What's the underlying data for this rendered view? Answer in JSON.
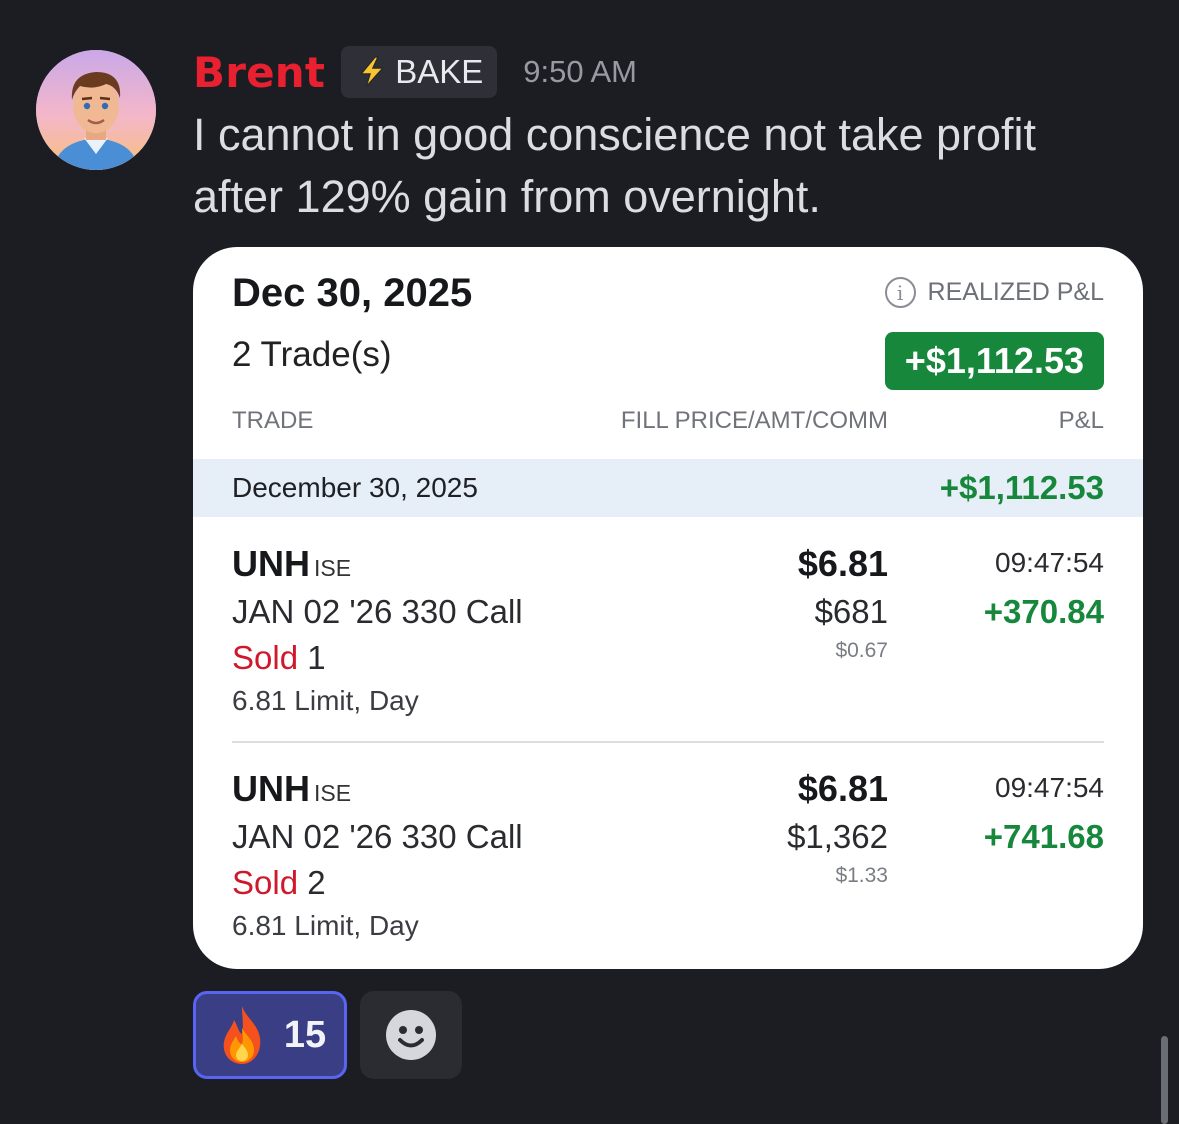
{
  "message": {
    "username": "Brent",
    "tag": "BAKE",
    "time": "9:50 AM",
    "text": "I cannot in good conscience not take profit after 129% gain from overnight."
  },
  "card": {
    "date": "Dec 30, 2025",
    "trades_count": "2 Trade(s)",
    "realized_label": "REALIZED P&L",
    "realized_total": "+$1,112.53",
    "columns": {
      "trade": "TRADE",
      "fill": "FILL PRICE/AMT/COMM",
      "pl": "P&L"
    },
    "day": {
      "label": "December 30, 2025",
      "pl": "+$1,112.53"
    },
    "trades": [
      {
        "symbol": "UNH",
        "exchange": "ISE",
        "contract": "JAN 02 '26 330 Call",
        "side": "Sold",
        "qty": "1",
        "order": "6.81 Limit, Day",
        "price": "$6.81",
        "amount": "$681",
        "commission": "$0.67",
        "time": "09:47:54",
        "pl": "+370.84"
      },
      {
        "symbol": "UNH",
        "exchange": "ISE",
        "contract": "JAN 02 '26 330 Call",
        "side": "Sold",
        "qty": "2",
        "order": "6.81 Limit, Day",
        "price": "$6.81",
        "amount": "$1,362",
        "commission": "$1.33",
        "time": "09:47:54",
        "pl": "+741.68"
      }
    ]
  },
  "reactions": [
    {
      "icon": "fire-icon",
      "count": "15"
    }
  ],
  "colors": {
    "username": "#e8202f",
    "profit_green": "#17873c",
    "sold_red": "#d0182b",
    "reaction_bg": "#3a3f85",
    "reaction_border": "#5865f2"
  }
}
